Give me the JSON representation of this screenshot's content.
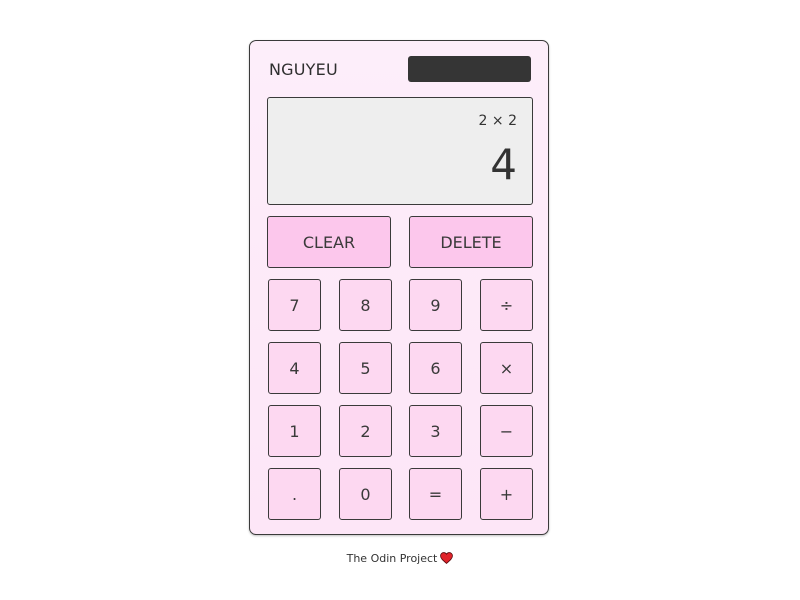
{
  "brand": "NGUYEU",
  "display": {
    "previous": "2 × 2",
    "current": "4"
  },
  "controls": {
    "clear": "CLEAR",
    "delete": "DELETE"
  },
  "keys": [
    {
      "label": "7",
      "name": "key-7"
    },
    {
      "label": "8",
      "name": "key-8"
    },
    {
      "label": "9",
      "name": "key-9"
    },
    {
      "label": "÷",
      "name": "key-divide"
    },
    {
      "label": "4",
      "name": "key-4"
    },
    {
      "label": "5",
      "name": "key-5"
    },
    {
      "label": "6",
      "name": "key-6"
    },
    {
      "label": "×",
      "name": "key-multiply"
    },
    {
      "label": "1",
      "name": "key-1"
    },
    {
      "label": "2",
      "name": "key-2"
    },
    {
      "label": "3",
      "name": "key-3"
    },
    {
      "label": "−",
      "name": "key-subtract"
    },
    {
      "label": ".",
      "name": "key-decimal"
    },
    {
      "label": "0",
      "name": "key-0"
    },
    {
      "label": "=",
      "name": "key-equals"
    },
    {
      "label": "+",
      "name": "key-add"
    }
  ],
  "footer": {
    "text": "The Odin Project",
    "icon": "heart-icon"
  },
  "colors": {
    "body": "#fdeefa",
    "button": "#fcd3f0",
    "screen": "#eeeeee",
    "solar_panel": "#353535",
    "heart": "#e0242b"
  }
}
